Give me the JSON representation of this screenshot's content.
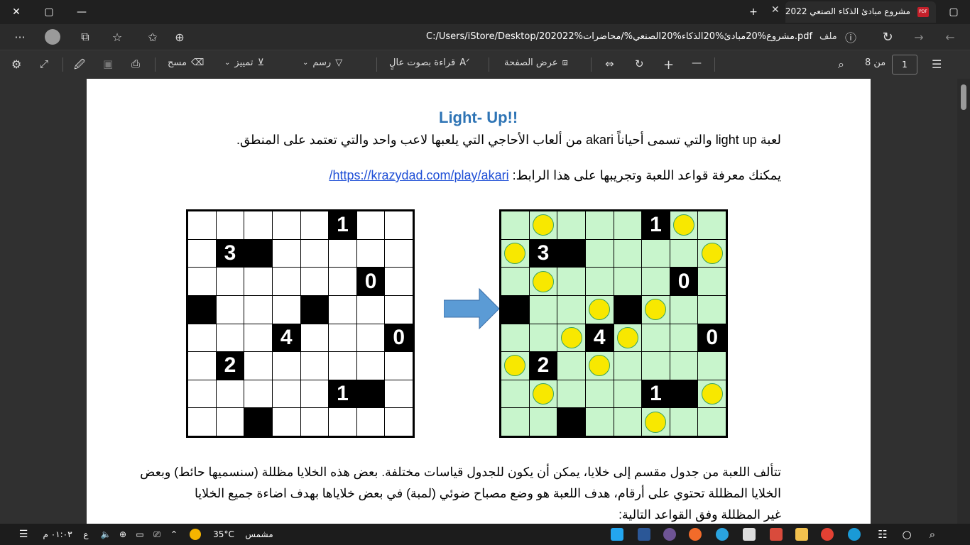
{
  "window": {
    "tab_title": "مشروع مبادئ الذكاء الصنعي 2022",
    "minimize": "—",
    "restore": "▢",
    "close": "✕",
    "new_tab": "+",
    "tab_close": "✕",
    "app_icon": "▢"
  },
  "address_bar": {
    "back": "←",
    "forward": "→",
    "refresh": "↻",
    "info_icon": "ⓘ",
    "file_label": "ملف",
    "url": "C:/Users/iStore/Desktop/202022%مشروع%20مبادئ%20الذكاء%20الصنعي%/محاضرات.pdf",
    "more": "···"
  },
  "pdf_toolbar": {
    "contents_icon": "☰",
    "page_current": "1",
    "page_total": "من 8",
    "search_icon": "⌕",
    "zoom_out": "—",
    "zoom_in": "+",
    "page_view": "عرض الصفحة",
    "read_aloud": "قراءة بصوت عالٍ",
    "draw": "رسم",
    "highlight": "تمييز",
    "erase": "مسح"
  },
  "document": {
    "heading": "Light- Up!!",
    "line1": "لعبة light up  والتي تسمى أحياناً akari من ألعاب الأحاجي التي يلعبها لاعب واحد والتي تعتمد على المنطق.",
    "line2_prefix": "يمكنك معرفة قواعد اللعبة وتجريبها على هذا الرابط: ",
    "line2_link": "https://krazydad.com/play/akari/",
    "body1": "تتألف اللعبة من جدول مقسم إلى خلايا، يمكن أن يكون للجدول قياسات مختلفة. بعض هذه الخلايا مظللة (سنسميها حائط) وبعض",
    "body2": "الخلايا المظللة تحتوي على أرقام، هدف اللعبة هو وضع مصباح ضوئي (لمبة) في بعض خلاياها بهدف اضاءة جميع الخلايا",
    "body3": "غير المظللة وفق القواعد التالية:"
  },
  "puzzle": {
    "walls": [
      {
        "row": 0,
        "col": 5,
        "label": "1"
      },
      {
        "row": 1,
        "col": 1,
        "label": "3"
      },
      {
        "row": 1,
        "col": 2,
        "label": ""
      },
      {
        "row": 2,
        "col": 6,
        "label": "0"
      },
      {
        "row": 3,
        "col": 0,
        "label": ""
      },
      {
        "row": 3,
        "col": 4,
        "label": ""
      },
      {
        "row": 4,
        "col": 3,
        "label": "4"
      },
      {
        "row": 4,
        "col": 7,
        "label": "0"
      },
      {
        "row": 5,
        "col": 1,
        "label": "2"
      },
      {
        "row": 6,
        "col": 5,
        "label": "1"
      },
      {
        "row": 6,
        "col": 6,
        "label": ""
      },
      {
        "row": 7,
        "col": 2,
        "label": ""
      }
    ],
    "bulbs": [
      {
        "row": 0,
        "col": 1
      },
      {
        "row": 0,
        "col": 6
      },
      {
        "row": 1,
        "col": 0
      },
      {
        "row": 1,
        "col": 7
      },
      {
        "row": 2,
        "col": 1
      },
      {
        "row": 3,
        "col": 3
      },
      {
        "row": 3,
        "col": 5
      },
      {
        "row": 4,
        "col": 2
      },
      {
        "row": 4,
        "col": 4
      },
      {
        "row": 5,
        "col": 0
      },
      {
        "row": 5,
        "col": 3
      },
      {
        "row": 6,
        "col": 1
      },
      {
        "row": 6,
        "col": 7
      },
      {
        "row": 7,
        "col": 5
      }
    ],
    "lit_color": "#c8f5cc",
    "bulb_color": "#f8e800",
    "arrow_color": "#5b9bd5"
  },
  "taskbar": {
    "weather_label": "مشمس",
    "temperature": "35°C",
    "time": "٠١:٠٣ م",
    "lang": "ع"
  }
}
